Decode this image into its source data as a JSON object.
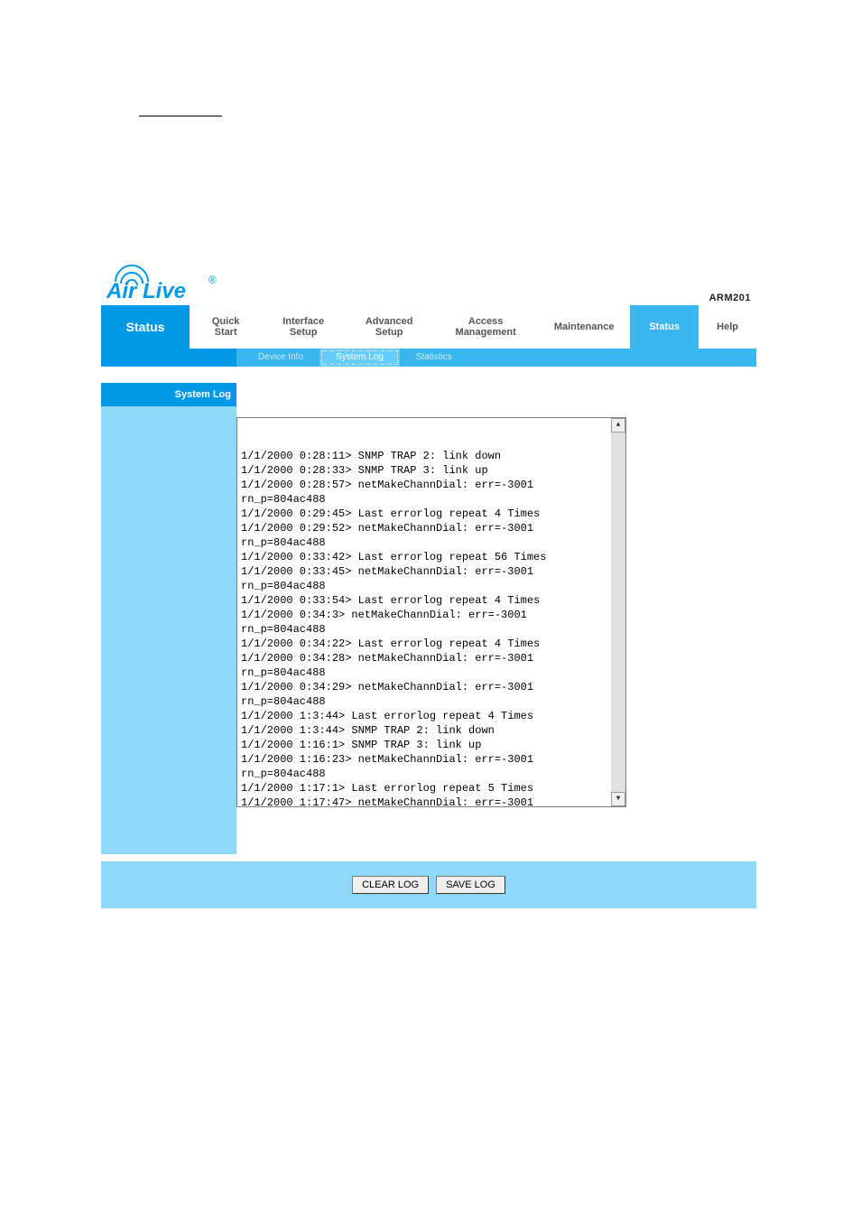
{
  "header": {
    "model": "ARM201",
    "page_title": "Status"
  },
  "nav": {
    "tabs": [
      "Quick\nStart",
      "Interface\nSetup",
      "Advanced\nSetup",
      "Access\nManagement",
      "Maintenance",
      "Status",
      "Help"
    ],
    "subtabs": [
      "Device Info",
      "System Log",
      "Statistics"
    ]
  },
  "sidebar": {
    "section": "System Log"
  },
  "log": {
    "content": "1/1/2000 0:28:11> SNMP TRAP 2: link down\n1/1/2000 0:28:33> SNMP TRAP 3: link up\n1/1/2000 0:28:57> netMakeChannDial: err=-3001\nrn_p=804ac488\n1/1/2000 0:29:45> Last errorlog repeat 4 Times\n1/1/2000 0:29:52> netMakeChannDial: err=-3001\nrn_p=804ac488\n1/1/2000 0:33:42> Last errorlog repeat 56 Times\n1/1/2000 0:33:45> netMakeChannDial: err=-3001\nrn_p=804ac488\n1/1/2000 0:33:54> Last errorlog repeat 4 Times\n1/1/2000 0:34:3> netMakeChannDial: err=-3001\nrn_p=804ac488\n1/1/2000 0:34:22> Last errorlog repeat 4 Times\n1/1/2000 0:34:28> netMakeChannDial: err=-3001\nrn_p=804ac488\n1/1/2000 0:34:29> netMakeChannDial: err=-3001\nrn_p=804ac488\n1/1/2000 1:3:44> Last errorlog repeat 4 Times\n1/1/2000 1:3:44> SNMP TRAP 2: link down\n1/1/2000 1:16:1> SNMP TRAP 3: link up\n1/1/2000 1:16:23> netMakeChannDial: err=-3001\nrn_p=804ac488\n1/1/2000 1:17:1> Last errorlog repeat 5 Times\n1/1/2000 1:17:47> netMakeChannDial: err=-3001"
  },
  "buttons": {
    "clear": "CLEAR LOG",
    "save": "SAVE LOG"
  }
}
